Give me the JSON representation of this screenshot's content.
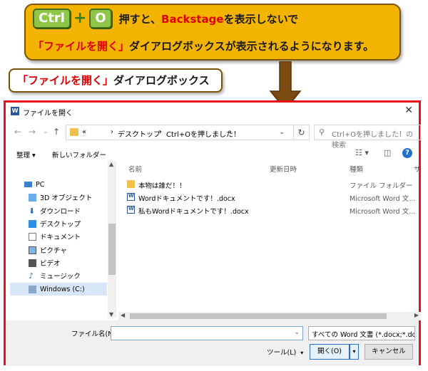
{
  "callout": {
    "key_ctrl": "Ctrl",
    "key_plus": "+",
    "key_o": "O",
    "line1_a": "押すと、",
    "line1_highlight": "Backstage",
    "line1_b": "を表示しないで",
    "line2_highlight": "「ファイルを開く」",
    "line2_b": "ダイアログボックスが表示されるようになります。"
  },
  "label": {
    "highlight": "「ファイルを開く」",
    "text": "ダイアログボックス"
  },
  "dialog": {
    "title": "ファイルを開く",
    "nav": {
      "back": "←",
      "forward": "→",
      "dropdown": "⌄",
      "up": "↑"
    },
    "address": {
      "overflow": "«",
      "sep1": "›",
      "crumb1": "デスクトップ",
      "sep2": "›",
      "crumb2": "Ctrl+Oを押しました！",
      "sep3": "›"
    },
    "search_placeholder": "Ctrl+Oを押しました！の検索",
    "toolbar": {
      "organize": "整理 ▾",
      "new_folder": "新しいフォルダー",
      "help": "?"
    },
    "sidebar": [
      {
        "label": "PC"
      },
      {
        "label": "3D オブジェクト"
      },
      {
        "label": "ダウンロード"
      },
      {
        "label": "デスクトップ"
      },
      {
        "label": "ドキュメント"
      },
      {
        "label": "ピクチャ"
      },
      {
        "label": "ビデオ"
      },
      {
        "label": "ミュージック"
      },
      {
        "label": "Windows (C:)"
      }
    ],
    "columns": {
      "name": "名前",
      "modified": "更新日時",
      "type": "種類",
      "size": "サ"
    },
    "files": [
      {
        "name": "本物は誰だ！！",
        "type": "ファイル フォルダー",
        "icon": "folder-icon"
      },
      {
        "name": "Wordドキュメントです！.docx",
        "type": "Microsoft Word 文...",
        "icon": "word-doc-icon"
      },
      {
        "name": "私もWordドキュメントです！.docx",
        "type": "Microsoft Word 文...",
        "icon": "word-doc-icon"
      }
    ],
    "footer": {
      "filename_label": "ファイル名(N):",
      "filename_value": "",
      "filter": "すべての Word 文書 (*.docx;*.doc",
      "tools": "ツール(L)",
      "open": "開く(O)",
      "cancel": "キャンセル"
    }
  },
  "colors": {
    "accent_red": "#e4141a",
    "callout_bg": "#f3b400",
    "key_green": "#8fc64a"
  }
}
